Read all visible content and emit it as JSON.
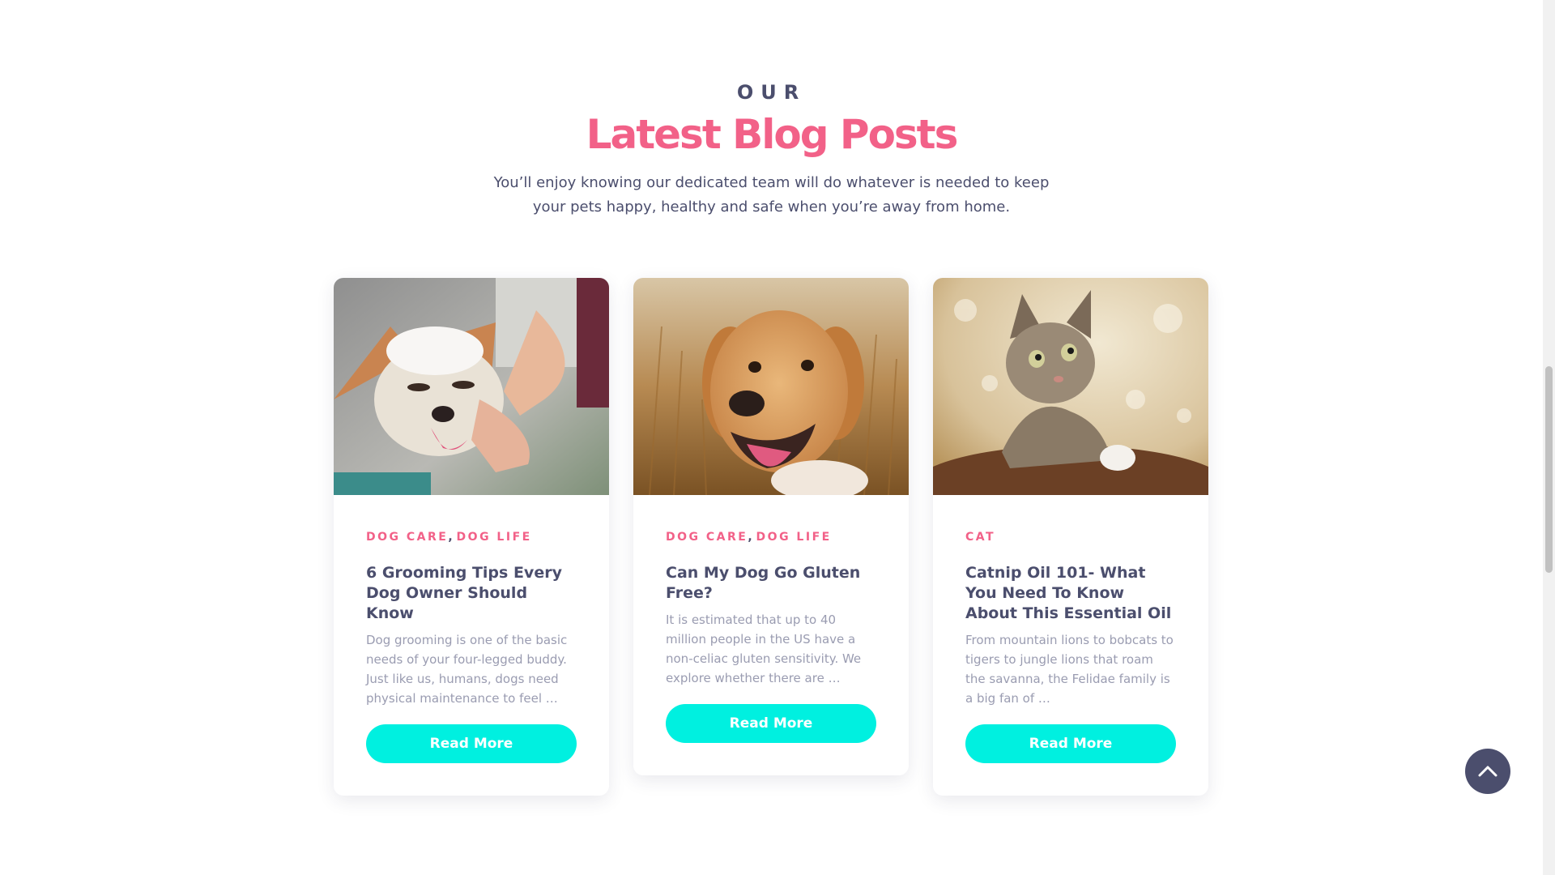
{
  "section": {
    "eyebrow": "OUR",
    "title": "Latest Blog Posts",
    "subtitle": "You’ll enjoy knowing our dedicated team will do whatever is needed to keep your pets happy, healthy and safe when you’re away from home."
  },
  "posts": [
    {
      "categories": [
        "DOG CARE",
        "DOG LIFE"
      ],
      "title": "6 Grooming Tips Every Dog Owner Should Know",
      "excerpt": "Dog grooming is one of the basic needs of your four-legged buddy. Just like us, humans, dogs need physical maintenance to feel …",
      "button_label": "Read More",
      "image": "corgi-bath-photo"
    },
    {
      "categories": [
        "DOG CARE",
        "DOG LIFE"
      ],
      "title": "Can My Dog Go Gluten Free?",
      "excerpt": "It is estimated that up to 40 million people in the US have a non-celiac gluten sensitivity. We explore whether there are …",
      "button_label": "Read More",
      "image": "golden-retriever-wheat-photo"
    },
    {
      "categories": [
        "CAT"
      ],
      "title": "Catnip Oil 101- What You Need To Know About This Essential Oil",
      "excerpt": "From mountain lions to bobcats to tigers to jungle lions that roam the savanna, the Felidae family is a big fan of …",
      "button_label": "Read More",
      "image": "kitten-photo"
    }
  ],
  "scroll_top": {
    "icon": "chevron-up-icon"
  },
  "colors": {
    "accent_pink": "#f26188",
    "accent_cyan": "#00f0e0",
    "text_dark": "#4b4e6d",
    "text_muted": "#9a9cb1"
  }
}
